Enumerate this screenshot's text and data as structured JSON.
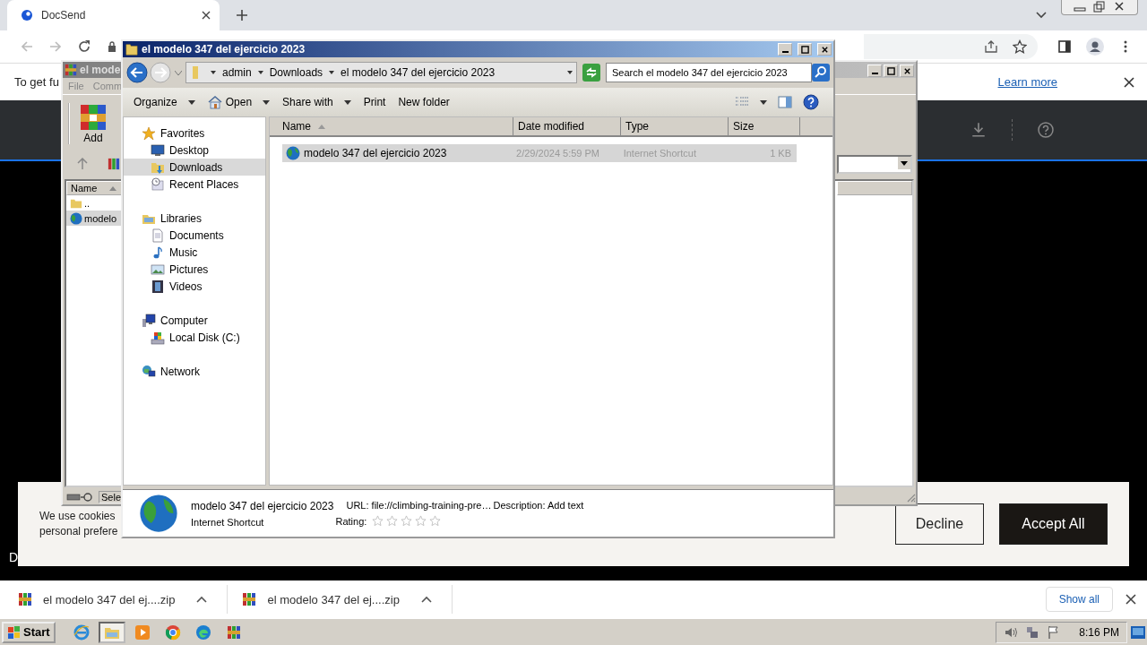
{
  "browser": {
    "tabs": [
      {
        "title": "DocSend",
        "selected": true
      }
    ],
    "infobar": {
      "text": "To get fu",
      "link": "Learn more"
    },
    "hidden_text": "D",
    "cookie_banner": {
      "lines": [
        "We use cookies",
        "personal prefere"
      ],
      "buttons": [
        {
          "label": "Decline",
          "primary": false
        },
        {
          "label": "Accept All",
          "primary": true
        }
      ]
    },
    "downloads": [
      {
        "name": "el modelo 347 del ej....zip"
      },
      {
        "name": "el modelo 347 del ej....zip"
      }
    ],
    "show_all": "Show all"
  },
  "winrar": {
    "title": "el mode",
    "menu": [
      "File",
      "Comm"
    ],
    "toolbar": [
      "Add"
    ],
    "column": "Name",
    "rows": [
      {
        "name": "..",
        "kind": "folder",
        "selected": false
      },
      {
        "name": "modelo",
        "kind": "globe",
        "selected": true
      }
    ],
    "status": "Sele"
  },
  "explorer": {
    "title": "el modelo 347 del ejercicio 2023",
    "breadcrumb": [
      "admin",
      "Downloads",
      "el modelo 347 del ejercicio 2023"
    ],
    "search": {
      "placeholder": "Search el modelo 347 del ejercicio 2023"
    },
    "toolbar": [
      {
        "label": "Organize",
        "kind": "plain",
        "dropdown": true
      },
      {
        "label": "Open",
        "kind": "open",
        "dropdown": true
      },
      {
        "label": "Share with",
        "kind": "plain",
        "dropdown": true
      },
      {
        "label": "Print",
        "kind": "plain",
        "dropdown": false
      },
      {
        "label": "New folder",
        "kind": "plain",
        "dropdown": false
      }
    ],
    "nav": [
      {
        "label": "Favorites",
        "kind": "star",
        "selected": false,
        "children": [
          {
            "label": "Desktop",
            "kind": "desktop",
            "selected": false
          },
          {
            "label": "Downloads",
            "kind": "downloads",
            "selected": true
          },
          {
            "label": "Recent Places",
            "kind": "recent",
            "selected": false
          }
        ]
      },
      {
        "label": "Libraries",
        "kind": "library",
        "selected": false,
        "children": [
          {
            "label": "Documents",
            "kind": "document",
            "selected": false
          },
          {
            "label": "Music",
            "kind": "music",
            "selected": false
          },
          {
            "label": "Pictures",
            "kind": "pictures",
            "selected": false
          },
          {
            "label": "Videos",
            "kind": "videos",
            "selected": false
          }
        ]
      },
      {
        "label": "Computer",
        "kind": "computer",
        "selected": false,
        "children": [
          {
            "label": "Local Disk (C:)",
            "kind": "disk",
            "selected": false
          }
        ]
      },
      {
        "label": "Network",
        "kind": "network",
        "selected": false
      }
    ],
    "columns": [
      {
        "label": "Name",
        "sorted": true
      },
      {
        "label": "Date modified",
        "sorted": false
      },
      {
        "label": "Type",
        "sorted": false
      },
      {
        "label": "Size",
        "sorted": false
      }
    ],
    "files": [
      {
        "name": "modelo 347 del ejercicio 2023",
        "date": "2/29/2024 5:59 PM",
        "type": "Internet Shortcut",
        "size": "1 KB",
        "selected": true
      }
    ],
    "details": {
      "name": "modelo 347 del ejercicio 2023",
      "type": "Internet Shortcut",
      "url": "URL: file://climbing-training-pre…",
      "description": "Description: Add text",
      "rating_label": "Rating:",
      "stars": 0
    }
  },
  "taskbar": {
    "start": "Start",
    "apps": [
      {
        "kind": "ie",
        "selected": false
      },
      {
        "kind": "explorer",
        "selected": true
      },
      {
        "kind": "media",
        "selected": false
      },
      {
        "kind": "chrome",
        "selected": false
      },
      {
        "kind": "edge",
        "selected": false
      },
      {
        "kind": "winrar",
        "selected": false
      }
    ],
    "time": "8:16 PM"
  }
}
